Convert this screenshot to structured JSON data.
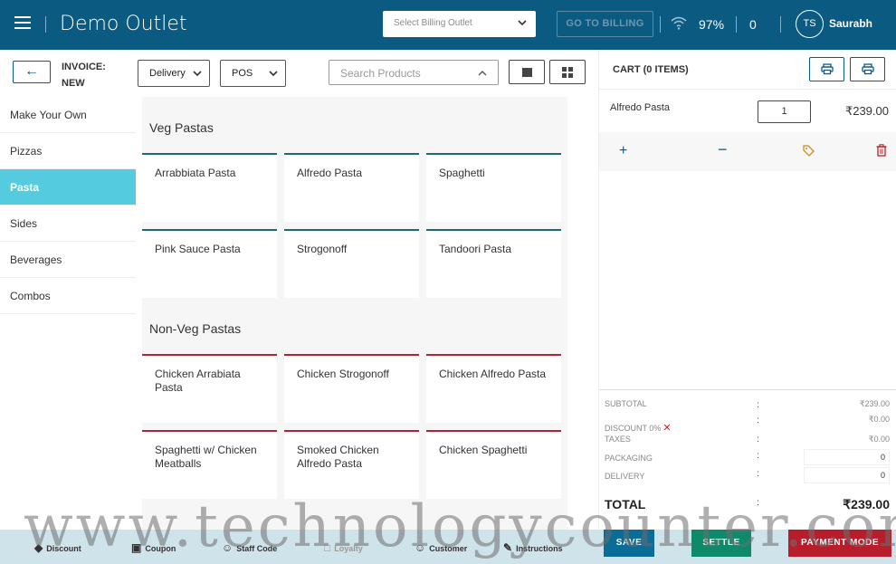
{
  "header": {
    "title": "Demo Outlet",
    "billing_outlet_placeholder": "Select Billing Outlet",
    "goto_billing": "GO TO BILLING",
    "signal": "97%",
    "count": "0",
    "user_initials": "TS",
    "user_name": "Saurabh"
  },
  "toolbar": {
    "invoice_label": "INVOICE: NEW",
    "order_type": "Delivery",
    "mode": "POS",
    "search_placeholder": "Search Products"
  },
  "categories": [
    "Make Your Own",
    "Pizzas",
    "Pasta",
    "Sides",
    "Beverages",
    "Combos"
  ],
  "sections": [
    {
      "title": "Veg Pastas",
      "items": [
        "Arrabbiata Pasta",
        "Alfredo Pasta",
        "Spaghetti",
        "Pink Sauce Pasta",
        "Strogonoff",
        "Tandoori Pasta"
      ]
    },
    {
      "title": "Non-Veg Pastas",
      "items": [
        "Chicken Arrabiata Pasta",
        "Chicken Strogonoff",
        "Chicken Alfredo Pasta",
        "Spaghetti w/ Chicken Meatballs",
        "Smoked Chicken Alfredo Pasta",
        "Chicken Spaghetti"
      ]
    }
  ],
  "cart": {
    "title": "CART (0 ITEMS)",
    "item_name": "Alfredo Pasta",
    "item_qty": "1",
    "item_price": "₹239.00",
    "subtotal_label": "SUBTOTAL",
    "subtotal": "₹239.00",
    "discount_label": "DISCOUNT 0%",
    "discount": "₹0.00",
    "taxes_label": "TAXES",
    "taxes": "₹0.00",
    "packaging_label": "PACKAGING",
    "packaging": "0",
    "delivery_label": "DELIVERY",
    "delivery": "0",
    "total_label": "TOTAL",
    "total": "₹239.00"
  },
  "bottom": {
    "discount": "Discount",
    "coupon": "Coupon",
    "staff_code": "Staff Code",
    "loyalty": "Loyalty",
    "customer": "Customer",
    "instructions": "Instructions",
    "save": "SAVE",
    "settle": "SETTLE",
    "payment_mode": "PAYMENT MODE"
  },
  "watermark": "www.technologycounter.com",
  "colors": {
    "primary": "#0b5a82",
    "active_category": "#55cbe0",
    "veg": "#1a6e6a",
    "nonveg": "#b32332"
  }
}
